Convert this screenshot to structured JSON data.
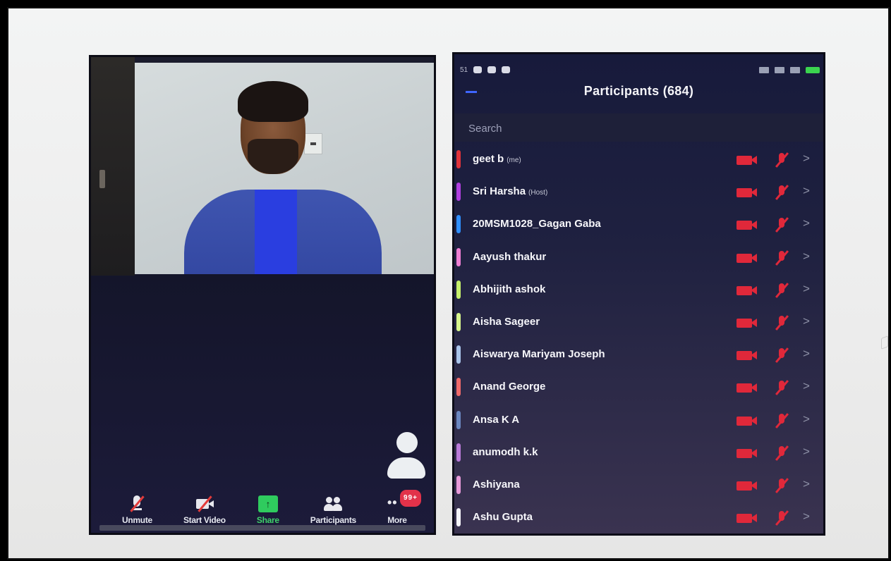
{
  "meeting": {
    "toolbar": [
      {
        "label": "Unmute",
        "icon": "mic-muted-icon"
      },
      {
        "label": "Start Video",
        "icon": "video-off-icon"
      },
      {
        "label": "Share",
        "icon": "share-screen-icon"
      },
      {
        "label": "Participants",
        "icon": "participants-icon"
      },
      {
        "label": "More",
        "icon": "more-icon",
        "badge": "99+"
      }
    ]
  },
  "participants_panel": {
    "title": "Participants (684)",
    "search_placeholder": "Search",
    "status_bar_left": "51",
    "participants": [
      {
        "name": "geet b",
        "tag": "(me)",
        "color": "#e0333a"
      },
      {
        "name": "Sri Harsha",
        "tag": "(Host)",
        "color": "#b13fe0"
      },
      {
        "name": "20MSM1028_Gagan Gaba",
        "tag": "",
        "color": "#2f8fff"
      },
      {
        "name": "Aayush thakur",
        "tag": "",
        "color": "#ee7fd3"
      },
      {
        "name": "Abhijith ashok",
        "tag": "",
        "color": "#c6f06b"
      },
      {
        "name": "Aisha Sageer",
        "tag": "",
        "color": "#d7f58c"
      },
      {
        "name": "Aiswarya Mariyam Joseph",
        "tag": "",
        "color": "#a9c4ea"
      },
      {
        "name": "Anand George",
        "tag": "",
        "color": "#f06a6a"
      },
      {
        "name": "Ansa K A",
        "tag": "",
        "color": "#6b87c0"
      },
      {
        "name": "anumodh k.k",
        "tag": "",
        "color": "#b97ad8"
      },
      {
        "name": "Ashiyana",
        "tag": "",
        "color": "#e79ad9"
      },
      {
        "name": "Ashu Gupta",
        "tag": "",
        "color": "#f4f4f8"
      }
    ]
  }
}
